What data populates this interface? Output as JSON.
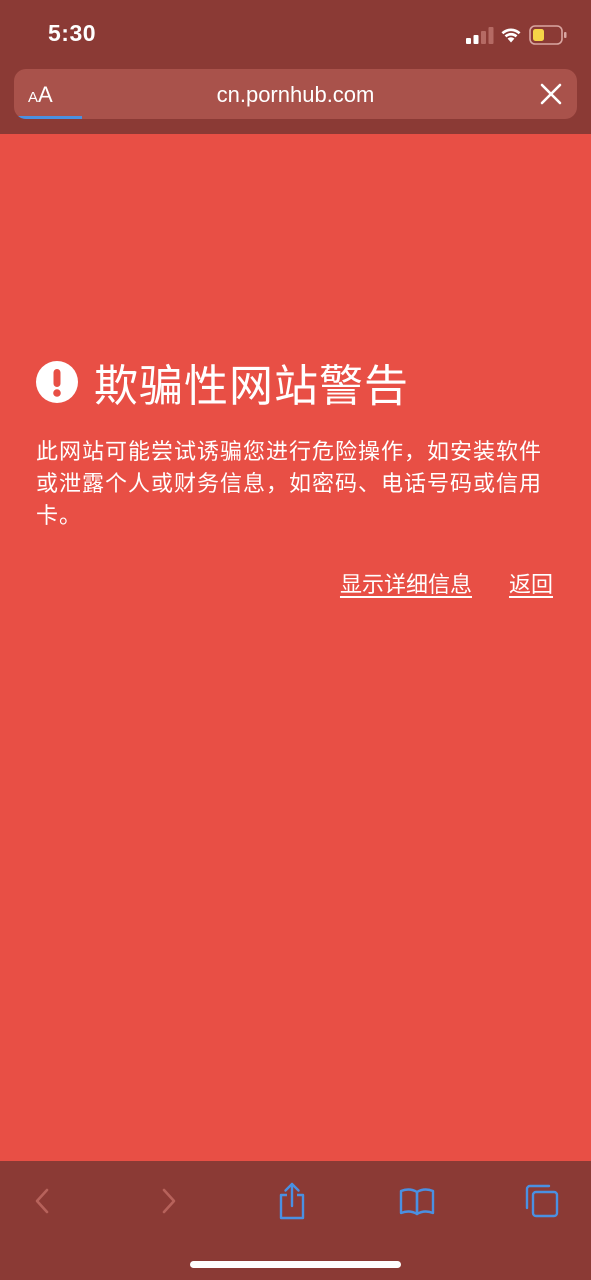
{
  "status_bar": {
    "time": "5:30"
  },
  "browser": {
    "text_size_small": "A",
    "text_size_large": "A",
    "url": "cn.pornhub.com",
    "load_progress": 0.12,
    "accent_color": "#4a90e2"
  },
  "warning": {
    "title": "欺骗性网站警告",
    "body": "此网站可能尝试诱骗您进行危险操作，如安装软件或泄露个人或财务信息，如密码、电话号码或信用卡。",
    "show_details_label": "显示详细信息",
    "go_back_label": "返回",
    "background_color": "#e84f45"
  },
  "toolbar": {
    "items": [
      "back-icon",
      "forward-icon",
      "share-icon",
      "bookmarks-icon",
      "tabs-icon"
    ],
    "icon_active_color": "#4a90e2",
    "icon_disabled_color": "#b7625b"
  }
}
